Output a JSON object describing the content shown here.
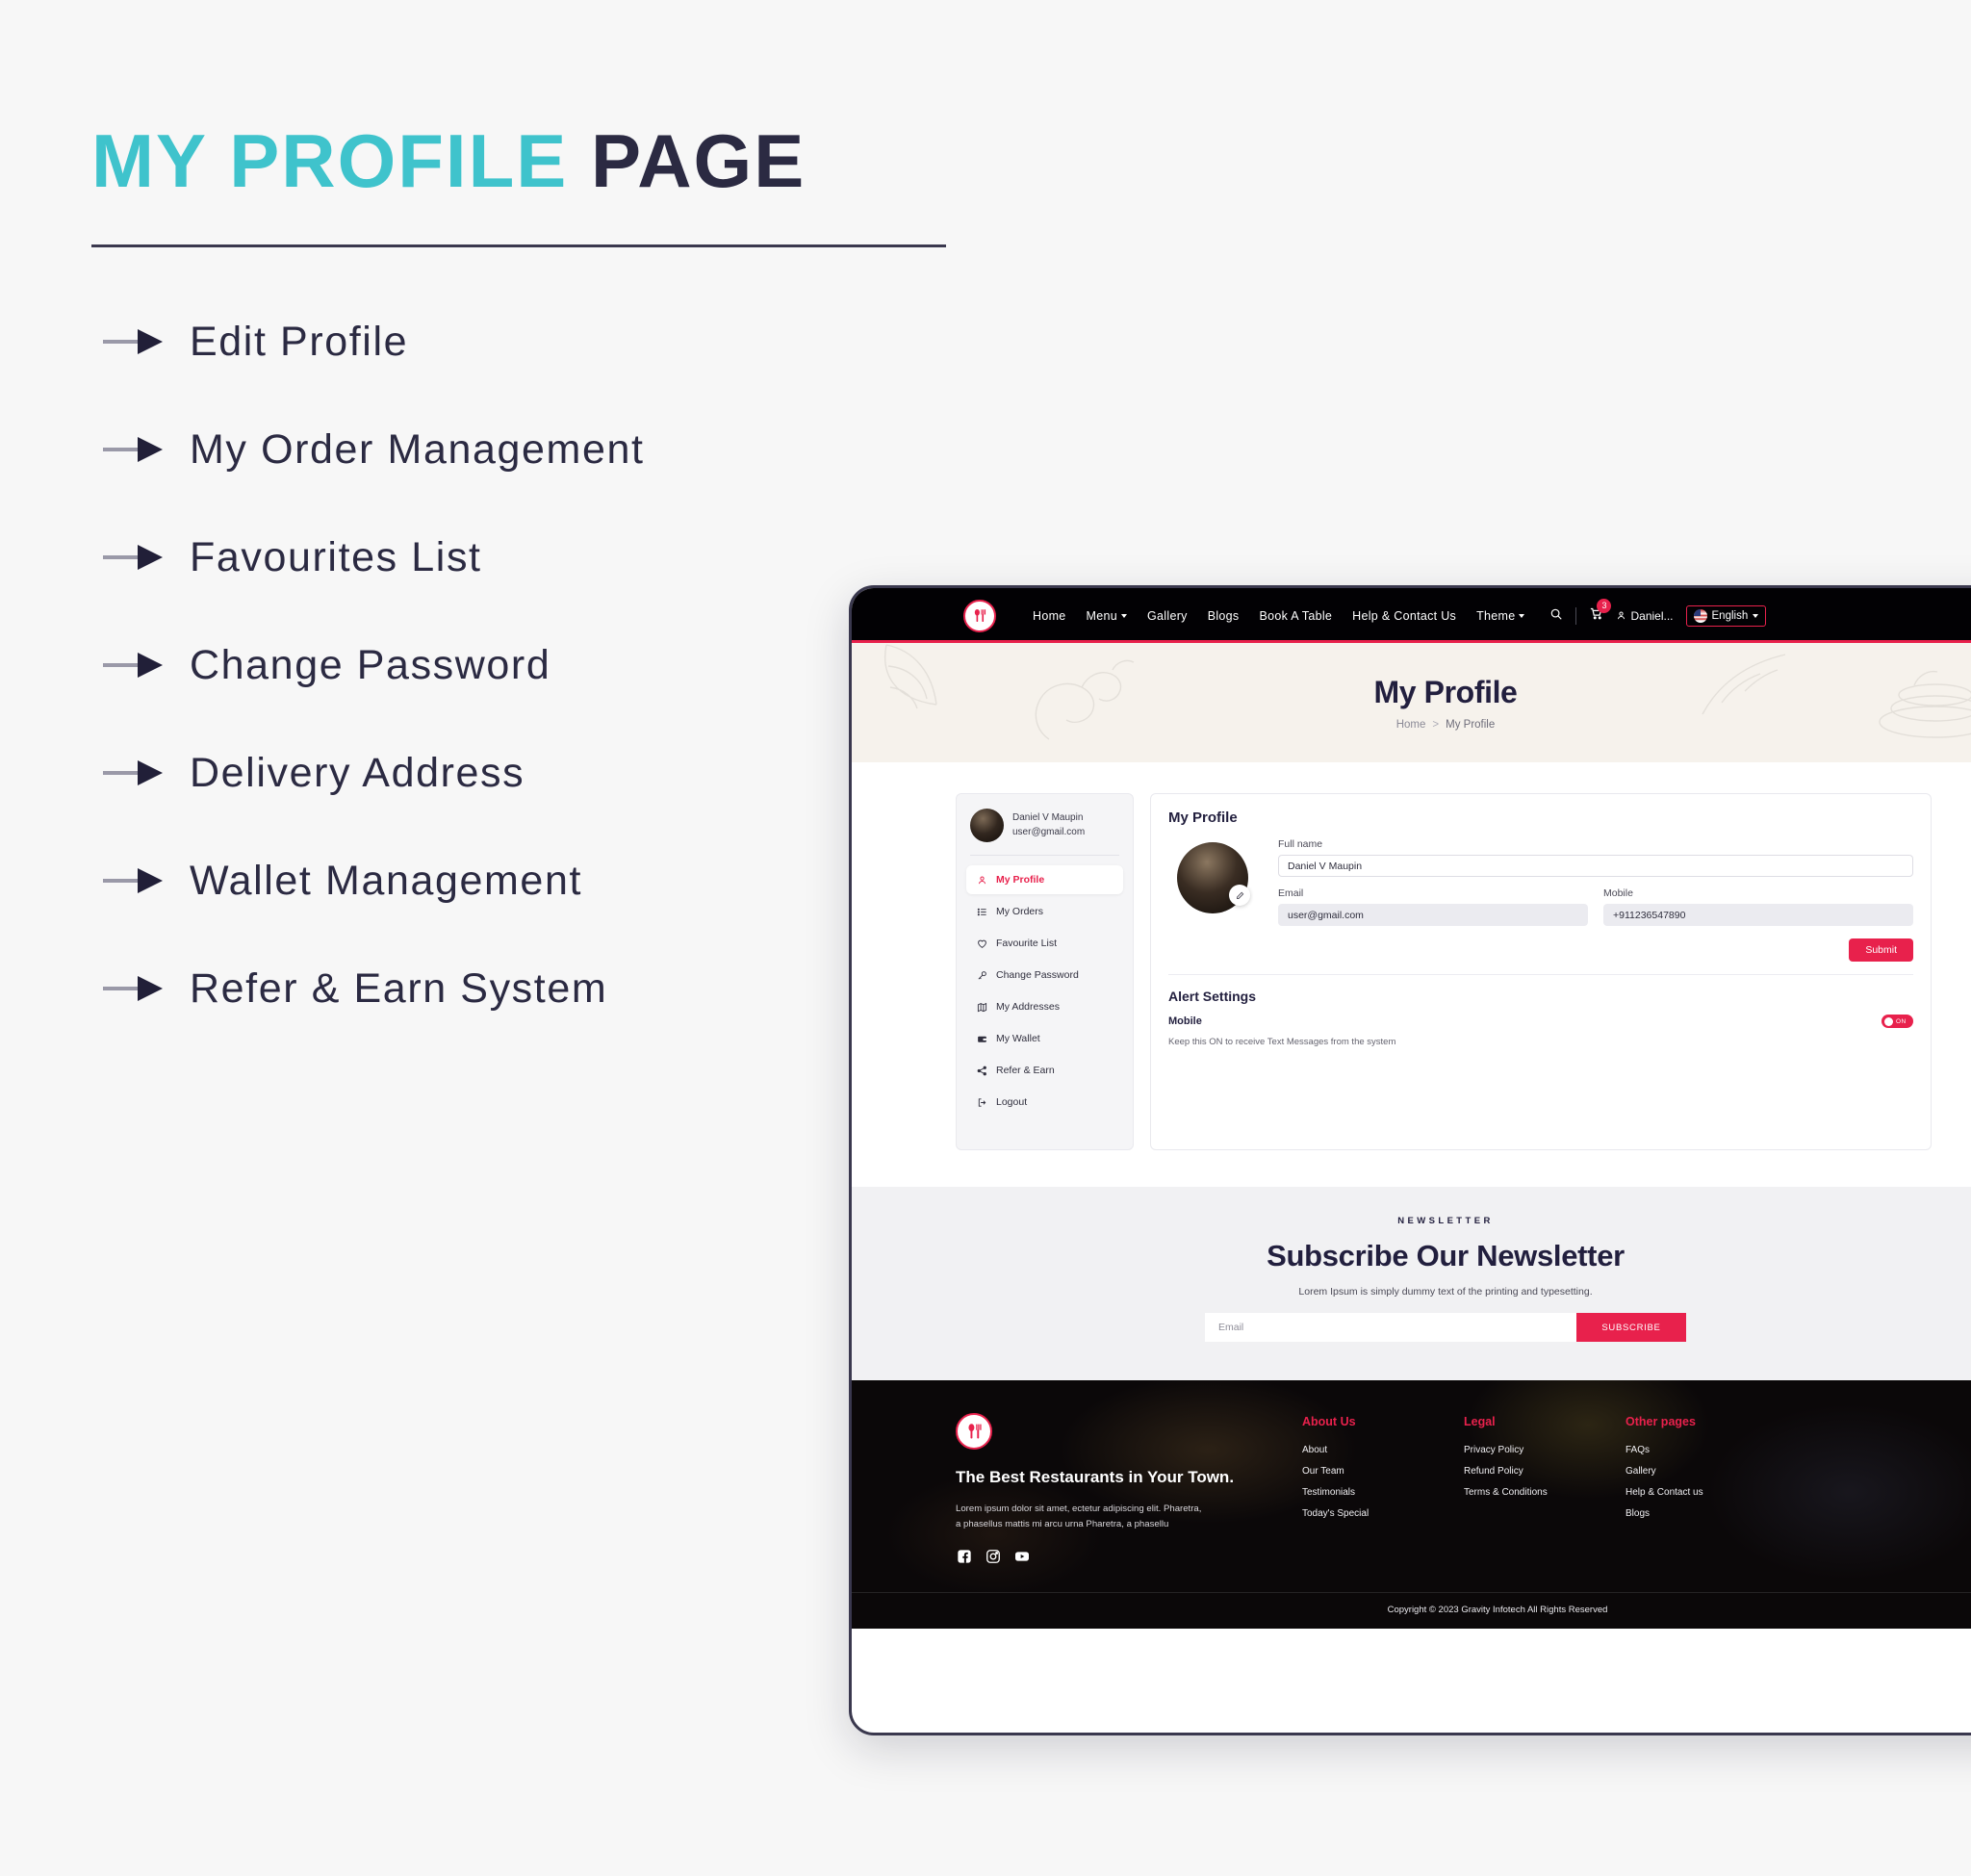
{
  "promo": {
    "title_accent": "MY PROFILE",
    "title_dark": "PAGE",
    "features": [
      "Edit Profile",
      "My Order Management",
      "Favourites List",
      "Change Password",
      "Delivery Address",
      "Wallet Management",
      "Refer & Earn System"
    ]
  },
  "colors": {
    "accent_teal": "#3fc3cc",
    "dark_navy": "#2b2a42",
    "brand_red": "#e8214c",
    "page_bg": "#f7f7f7",
    "hero_bg": "#f6f2ec"
  },
  "site": {
    "nav": {
      "logo_icon": "spoon-fork-logo-icon",
      "links": [
        {
          "label": "Home",
          "has_caret": false
        },
        {
          "label": "Menu",
          "has_caret": true
        },
        {
          "label": "Gallery",
          "has_caret": false
        },
        {
          "label": "Blogs",
          "has_caret": false
        },
        {
          "label": "Book A Table",
          "has_caret": false
        },
        {
          "label": "Help & Contact Us",
          "has_caret": false
        },
        {
          "label": "Theme",
          "has_caret": true
        }
      ],
      "search_icon": "search-icon",
      "cart_icon": "cart-icon",
      "cart_count": "3",
      "user_label": "Daniel...",
      "user_icon": "user-icon",
      "language": "English",
      "language_flag": "us-flag-icon"
    },
    "hero": {
      "title": "My Profile",
      "breadcrumb_home": "Home",
      "breadcrumb_sep": ">",
      "breadcrumb_current": "My Profile"
    },
    "account_sidebar": {
      "user_name": "Daniel V Maupin",
      "user_email": "user@gmail.com",
      "items": [
        {
          "label": "My Profile",
          "icon": "user-icon",
          "active": true
        },
        {
          "label": "My Orders",
          "icon": "list-icon",
          "active": false
        },
        {
          "label": "Favourite List",
          "icon": "heart-icon",
          "active": false
        },
        {
          "label": "Change Password",
          "icon": "key-icon",
          "active": false
        },
        {
          "label": "My Addresses",
          "icon": "map-icon",
          "active": false
        },
        {
          "label": "My Wallet",
          "icon": "wallet-icon",
          "active": false
        },
        {
          "label": "Refer & Earn",
          "icon": "share-icon",
          "active": false
        },
        {
          "label": "Logout",
          "icon": "logout-icon",
          "active": false
        }
      ]
    },
    "profile_card": {
      "heading": "My Profile",
      "avatar_edit_icon": "pencil-icon",
      "fullname_label": "Full name",
      "fullname_value": "Daniel V Maupin",
      "email_label": "Email",
      "email_value": "user@gmail.com",
      "mobile_label": "Mobile",
      "mobile_value": "+911236547890",
      "submit_label": "Submit"
    },
    "alert_settings": {
      "heading": "Alert Settings",
      "row_label": "Mobile",
      "toggle_state": "ON",
      "description": "Keep this ON to receive Text Messages from the system"
    },
    "newsletter": {
      "kicker": "NEWSLETTER",
      "title": "Subscribe Our Newsletter",
      "subtitle": "Lorem Ipsum is simply dummy text of the printing and typesetting.",
      "input_placeholder": "Email",
      "button_label": "SUBSCRIBE"
    },
    "footer": {
      "logo_icon": "spoon-fork-logo-icon",
      "tagline": "The Best Restaurants in Your Town.",
      "description": "Lorem ipsum dolor sit amet, ectetur adipiscing elit. Pharetra, a phasellus mattis mi arcu urna Pharetra, a phasellu",
      "socials": [
        {
          "name": "facebook-icon"
        },
        {
          "name": "instagram-icon"
        },
        {
          "name": "youtube-icon"
        }
      ],
      "columns": [
        {
          "heading": "About Us",
          "links": [
            "About",
            "Our Team",
            "Testimonials",
            "Today's Special"
          ]
        },
        {
          "heading": "Legal",
          "links": [
            "Privacy Policy",
            "Refund Policy",
            "Terms & Conditions"
          ]
        },
        {
          "heading": "Other pages",
          "links": [
            "FAQs",
            "Gallery",
            "Help & Contact us",
            "Blogs"
          ]
        }
      ],
      "copyright": "Copyright © 2023 Gravity Infotech All Rights Reserved"
    }
  }
}
